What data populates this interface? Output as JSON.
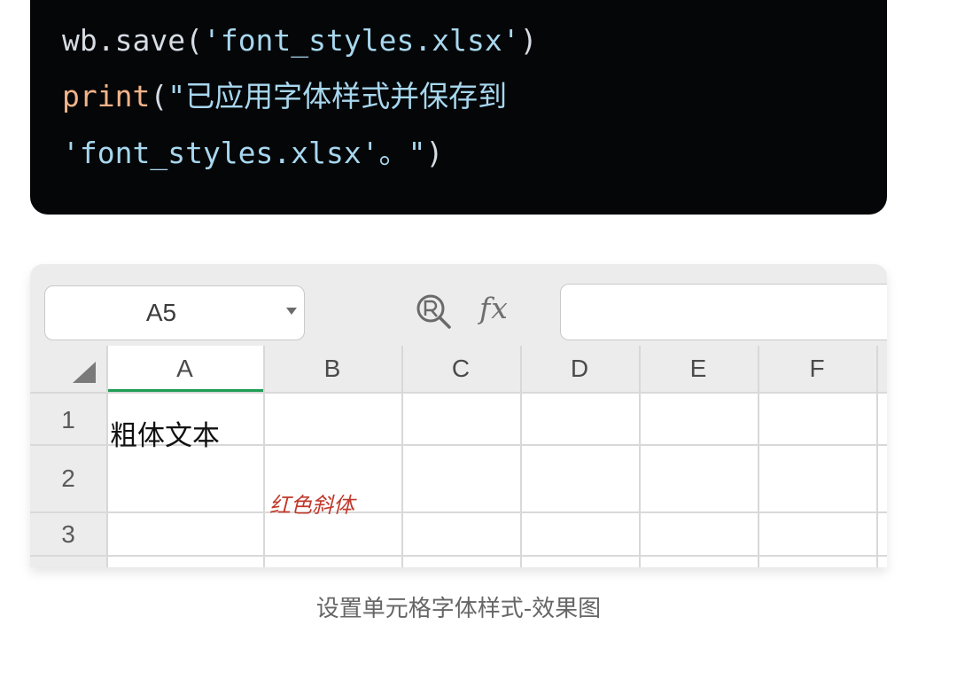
{
  "code": {
    "line1": {
      "prefix": "wb.save(",
      "string": "'font_styles.xlsx'",
      "suffix": ")"
    },
    "line2": {
      "fn": "print",
      "paren": "(",
      "string": "\"已应用字体样式并保存到"
    },
    "line3": {
      "string": "'font_styles.xlsx'。\"",
      "suffix": ")"
    },
    "colors": {
      "background": "#050608",
      "string": "#a7d7ee",
      "function": "#f2b48a",
      "plain": "#d6dce4"
    }
  },
  "spreadsheet": {
    "name_box_value": "A5",
    "fx_label": "fx",
    "icons": {
      "zoom": "zoom-magnifier-icon",
      "dropdown": "chevron-down-icon",
      "corner": "select-all-triangle-icon"
    },
    "columns": [
      "A",
      "B",
      "C",
      "D",
      "E",
      "F"
    ],
    "rows": [
      "1",
      "2",
      "3"
    ],
    "cells": {
      "A1": "粗体文本",
      "B2": "红色斜体"
    },
    "colors": {
      "selected_column_underline": "#1f9d55",
      "b2_text": "#c0392b"
    }
  },
  "caption": "设置单元格字体样式-效果图"
}
